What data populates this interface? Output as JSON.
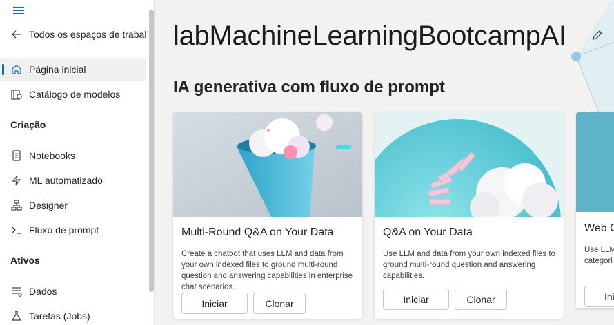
{
  "sidebar": {
    "back_label": "Todos os espaços de trabalho",
    "items": [
      {
        "label": "Página inicial"
      },
      {
        "label": "Catálogo de modelos"
      },
      {
        "label": "Notebooks"
      },
      {
        "label": "ML automatizado"
      },
      {
        "label": "Designer"
      },
      {
        "label": "Fluxo de prompt"
      },
      {
        "label": "Dados"
      },
      {
        "label": "Tarefas (Jobs)"
      }
    ],
    "sections": {
      "criacao": "Criação",
      "ativos": "Ativos"
    }
  },
  "main": {
    "workspace_title": "labMachineLearningBootcampAI",
    "section_title": "IA generativa com fluxo de prompt",
    "more": "···",
    "cards": [
      {
        "title": "Multi-Round Q&A on Your Data",
        "description": "Create a chatbot that uses LLM and data from your own indexed files to ground multi-round question and answering capabilities in enterprise chat scenarios.",
        "primary_label": "Iniciar",
        "secondary_label": "Clonar"
      },
      {
        "title": "Q&A on Your Data",
        "description": "Use LLM and data from your own indexed files to ground multi-round question and answering capabilities.",
        "primary_label": "Iniciar",
        "secondary_label": "Clonar"
      },
      {
        "title": "Web C",
        "description": "Use LLM categori",
        "primary_label": "Ini"
      }
    ]
  },
  "colors": {
    "accent": "#0f6cbd",
    "background": "#f3f2f1"
  }
}
